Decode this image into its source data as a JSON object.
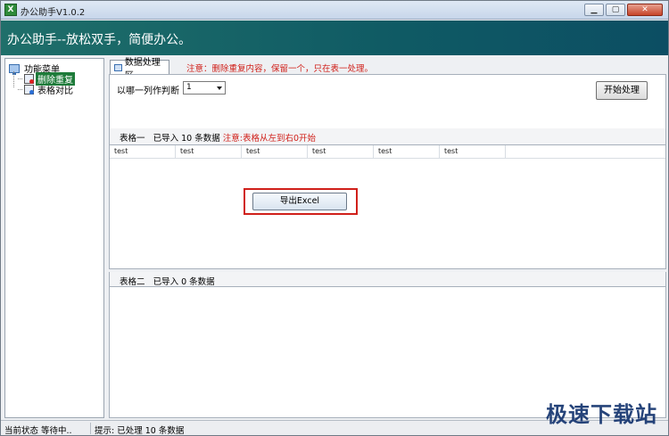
{
  "window": {
    "title": "办公助手V1.0.2"
  },
  "banner": {
    "text": "办公助手--放松双手，简便办公。"
  },
  "sidebar": {
    "root": "功能菜单",
    "items": [
      {
        "label": "删除重复",
        "selected": true
      },
      {
        "label": "表格对比",
        "selected": false
      }
    ]
  },
  "tab": {
    "label": "数据处理区"
  },
  "notice_top": "注意：删除重复内容，保留一个，只在表一处理。",
  "controls": {
    "column_label": "以哪一列作判断",
    "column_value": "1",
    "start_button": "开始处理"
  },
  "table1": {
    "name": "表格一",
    "imported": "已导入 10 条数据",
    "note": "注意:表格从左到右0开始",
    "columns": [
      "test",
      "test",
      "test",
      "test",
      "test",
      "test"
    ]
  },
  "export_button": "导出Excel",
  "table2": {
    "name": "表格二",
    "imported": "已导入 0 条数据"
  },
  "status": {
    "left": "当前状态  等待中..",
    "right": "提示: 已处理 10 条数据"
  },
  "watermark": "极速下载站"
}
